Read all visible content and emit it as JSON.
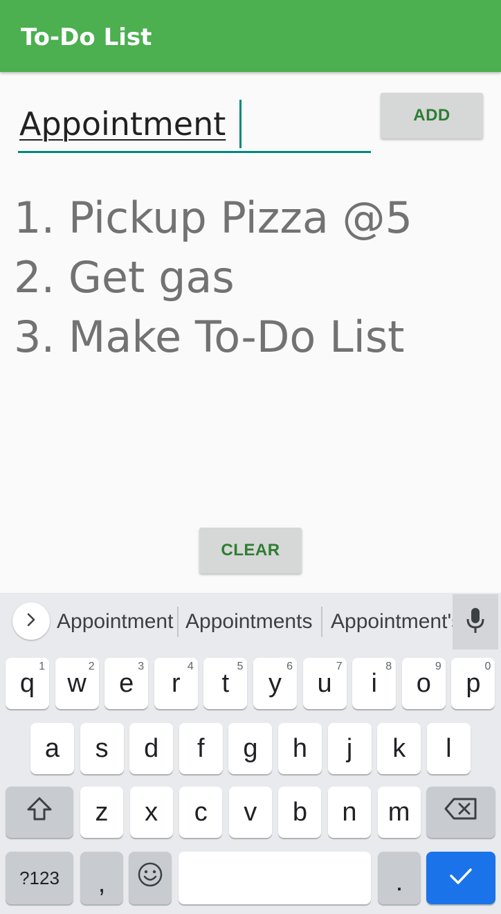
{
  "appbar": {
    "title": "To-Do List"
  },
  "input": {
    "value": "Appointment"
  },
  "buttons": {
    "add": "ADD",
    "clear": "CLEAR"
  },
  "todos": [
    "1. Pickup Pizza @5",
    "2. Get gas",
    "3. Make To-Do List"
  ],
  "keyboard": {
    "suggestions": [
      "Appointment",
      "Appointments",
      "Appointment's"
    ],
    "row1": [
      {
        "key": "q",
        "hint": "1"
      },
      {
        "key": "w",
        "hint": "2"
      },
      {
        "key": "e",
        "hint": "3"
      },
      {
        "key": "r",
        "hint": "4"
      },
      {
        "key": "t",
        "hint": "5"
      },
      {
        "key": "y",
        "hint": "6"
      },
      {
        "key": "u",
        "hint": "7"
      },
      {
        "key": "i",
        "hint": "8"
      },
      {
        "key": "o",
        "hint": "9"
      },
      {
        "key": "p",
        "hint": "0"
      }
    ],
    "row2": [
      "a",
      "s",
      "d",
      "f",
      "g",
      "h",
      "j",
      "k",
      "l"
    ],
    "row3": [
      "z",
      "x",
      "c",
      "v",
      "b",
      "n",
      "m"
    ],
    "symbols_label": "?123",
    "comma": ",",
    "period": ".",
    "colors": {
      "accent": "#1a73e8",
      "appbar": "#4caf50",
      "input_line": "#00897b"
    }
  }
}
